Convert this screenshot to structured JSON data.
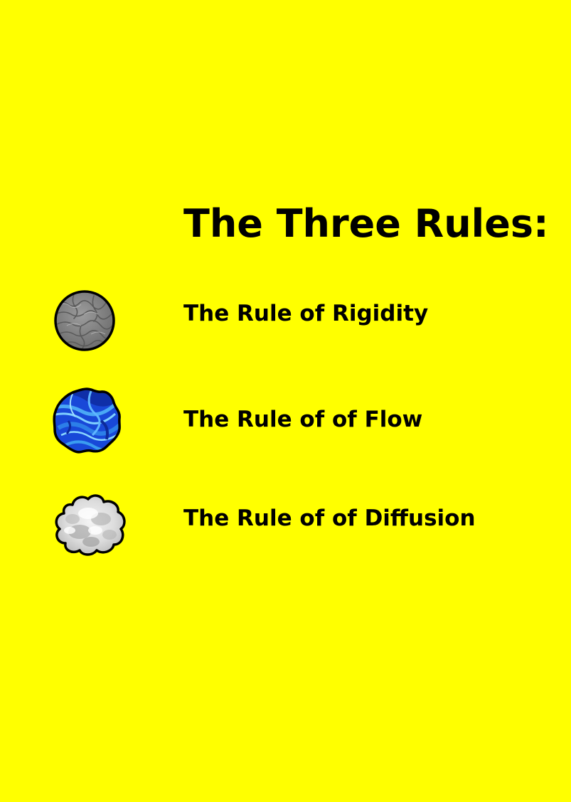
{
  "page": {
    "background": "#FFFF00",
    "text_color": "#000000"
  },
  "title": "The Three Rules:",
  "rules": [
    {
      "label": "The Rule of Rigidity",
      "icon": "stone-orb-icon",
      "icon_color": "#8A8A8A"
    },
    {
      "label": "The Rule of of Flow",
      "icon": "water-orb-icon",
      "icon_color": "#1E5BE6"
    },
    {
      "label": "The Rule of of Diffusion",
      "icon": "cloud-orb-icon",
      "icon_color": "#E2E2E2"
    }
  ]
}
